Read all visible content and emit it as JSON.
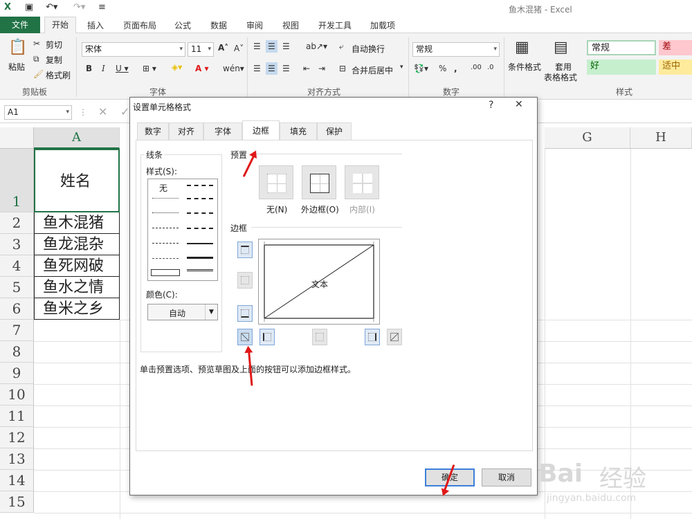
{
  "window": {
    "title": "鱼木混猪 - Excel"
  },
  "ribbon_tabs": [
    "文件",
    "开始",
    "插入",
    "页面布局",
    "公式",
    "数据",
    "审阅",
    "视图",
    "开发工具",
    "加载项"
  ],
  "clipboard": {
    "paste": "粘贴",
    "cut": "剪切",
    "copy": "复制",
    "format_painter": "格式刷",
    "group": "剪贴板"
  },
  "font": {
    "name": "宋体",
    "size": "11",
    "group": "字体"
  },
  "alignment": {
    "wrap": "自动换行",
    "merge": "合并后居中",
    "group": "对齐方式"
  },
  "number": {
    "format": "常规",
    "group": "数字"
  },
  "styles": {
    "conditional": "条件格式",
    "table": "套用",
    "table2": "表格格式",
    "normal": "常规",
    "bad": "差",
    "good": "好",
    "neutral": "适中",
    "group": "样式"
  },
  "formula_bar": {
    "name_box": "A1"
  },
  "columns": [
    "A",
    "G",
    "H"
  ],
  "rows": [
    "1",
    "2",
    "3",
    "4",
    "5",
    "6",
    "7",
    "8",
    "9",
    "10",
    "11",
    "12",
    "13",
    "14",
    "15"
  ],
  "cells": [
    "姓名",
    "鱼木混猪",
    "鱼龙混杂",
    "鱼死网破",
    "鱼水之情",
    "鱼米之乡"
  ],
  "dialog": {
    "title": "设置单元格格式",
    "help": "?",
    "close": "✕",
    "tabs": [
      "数字",
      "对齐",
      "字体",
      "边框",
      "填充",
      "保护"
    ],
    "active_tab": "边框",
    "line_group": "线条",
    "style_label": "样式(S):",
    "none_style": "无",
    "color_label": "颜色(C):",
    "color_value": "自动",
    "preset_group": "预置",
    "preset_none": "无(N)",
    "preset_outline": "外边框(O)",
    "preset_inside": "内部(I)",
    "border_group": "边框",
    "preview_text": "文本",
    "hint": "单击预置选项、预览草图及上面的按钮可以添加边框样式。",
    "ok": "确定",
    "cancel": "取消"
  },
  "watermark": {
    "brand": "Bai",
    "brand2": "经验",
    "url": "jingyan.baidu.com"
  }
}
